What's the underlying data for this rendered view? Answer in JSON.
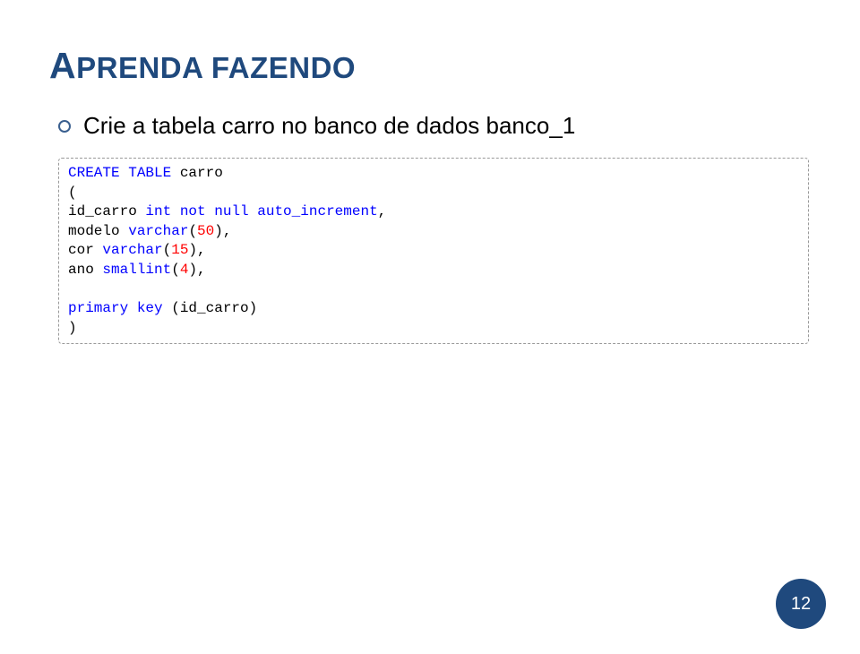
{
  "title_first": "A",
  "title_rest": "PRENDA FAZENDO",
  "bullet_text": "Crie a tabela carro no banco de dados banco_1",
  "code": {
    "kw_create": "CREATE TABLE ",
    "create_name": "carro",
    "open_paren": "(",
    "id_field": "id_carro ",
    "kw_int": "int ",
    "kw_not_null": "not null ",
    "kw_auto_inc": "auto_increment",
    "comma1": ",",
    "modelo_field": "modelo ",
    "kw_varchar": "varchar",
    "open_p": "(",
    "num50": "50",
    "close_p_comma": "),",
    "cor_field": "cor ",
    "num15": "15",
    "ano_field": "ano ",
    "kw_smallint": "smallint",
    "num4": "4",
    "kw_primary": "primary key ",
    "pk_field": "(id_carro)",
    "close_paren": ")"
  },
  "page_number": "12"
}
